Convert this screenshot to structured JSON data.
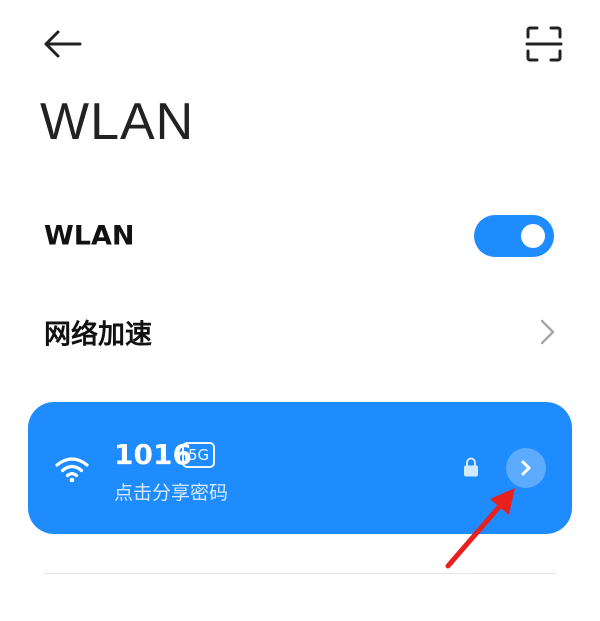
{
  "header": {
    "back_icon": "arrow-left-icon",
    "scan_icon": "scan-icon",
    "title": "WLAN"
  },
  "settings": {
    "wlan_label": "WLAN",
    "wlan_enabled": true,
    "accel_label": "网络加速"
  },
  "connected_network": {
    "name": "1016",
    "band": "5G",
    "subtitle": "点击分享密码",
    "secured": true
  },
  "colors": {
    "accent": "#1e8bff",
    "annotation": "#e8211f"
  }
}
